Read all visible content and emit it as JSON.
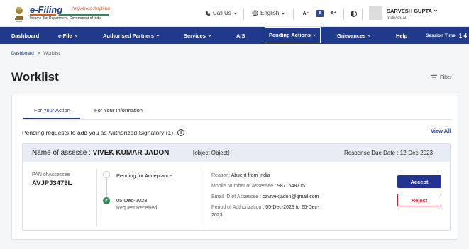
{
  "header": {
    "logo_title": "e-Filing",
    "logo_tagline": "Anywhere Anytime",
    "logo_subtitle": "Income Tax Department, Government of India",
    "call_us": "Call Us",
    "language": "English",
    "font_small": "A⁻",
    "font_normal": "A",
    "font_large": "A⁺",
    "user_name": "SARVESH GUPTA",
    "user_role": "Individual"
  },
  "nav": {
    "items": [
      {
        "label": "Dashboard"
      },
      {
        "label": "e-File"
      },
      {
        "label": "Authorised Partners"
      },
      {
        "label": "Services"
      },
      {
        "label": "AIS"
      },
      {
        "label": "Pending Actions"
      },
      {
        "label": "Grievances"
      },
      {
        "label": "Help"
      }
    ],
    "session_label": "Session Time",
    "session_value": "1  4"
  },
  "breadcrumb": {
    "home": "Dashboard",
    "separator": ">",
    "current": "Worklist"
  },
  "page": {
    "title": "Worklist",
    "filter_label": "Filter"
  },
  "tabs": [
    {
      "label": "For Your Action"
    },
    {
      "label": "For Your Information"
    }
  ],
  "pending": {
    "title": "Pending requests to add you as Authorized Signatory (1)",
    "view_all": "View All"
  },
  "request": {
    "name_label": "Name of assesse :",
    "name_value": "VIVEK KUMAR JADON",
    "object_text": "[object Object]",
    "due_label": "Response Due Date :",
    "due_value": "12-Dec-2023",
    "pan_label": "PAN of Assessee",
    "pan_value": "AVJPJ3479L",
    "status_current": "Pending for Acceptance",
    "status_date": "05-Dec-2023",
    "status_done": "Request Received",
    "reason_label": "Reason:",
    "reason_value": "Absent from India",
    "mobile_label": "Mobile Number of Assessee :",
    "mobile_value": "9871648715",
    "email_label": "Email ID of Assessee :",
    "email_value": "cavivekjadon@gmail.com",
    "period_label": "Period of Authorization :",
    "period_value": "05-Dec-2023 to 20-Dec-",
    "period_value_2": "2023",
    "accept_label": "Accept",
    "reject_label": "Reject"
  },
  "colors": {
    "nav_bg": "#1f3a8a",
    "accent": "#23338f",
    "reject": "#c0262d",
    "success": "#2e8b57"
  }
}
